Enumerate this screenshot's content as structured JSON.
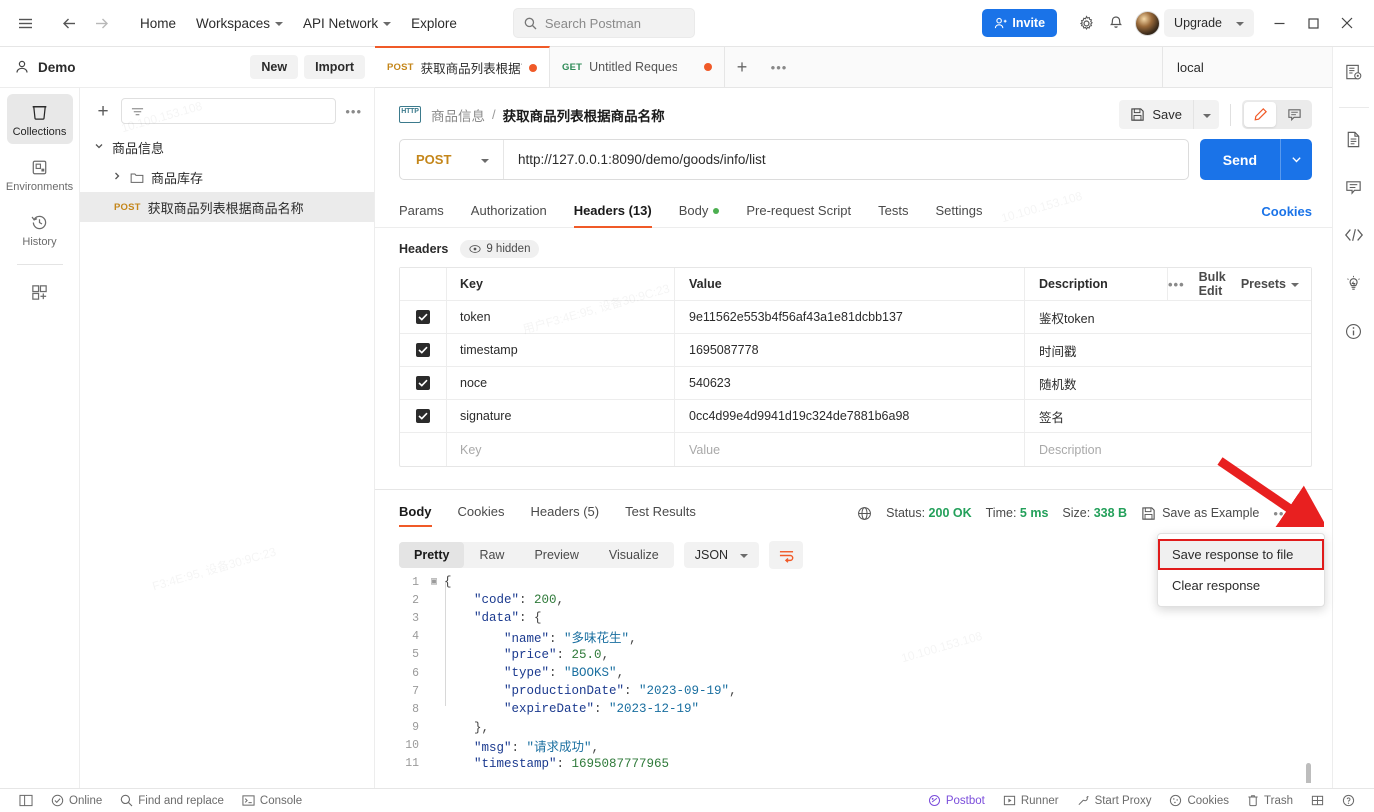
{
  "topbar": {
    "menu_icon": "hamburger-icon",
    "back_icon": "back-arrow-icon",
    "forward_icon": "forward-arrow-icon",
    "home": "Home",
    "workspaces": "Workspaces",
    "api_network": "API Network",
    "explore": "Explore",
    "search_placeholder": "Search Postman",
    "invite": "Invite",
    "settings_icon": "gear-icon",
    "notifications_icon": "bell-icon",
    "avatar": "user-avatar",
    "upgrade": "Upgrade",
    "minimize": "–",
    "maximize": "□",
    "close": "✕"
  },
  "workspace": {
    "name": "Demo",
    "new_label": "New",
    "import_label": "Import"
  },
  "rail": {
    "items": [
      {
        "label": "Collections",
        "icon": "collections-icon",
        "active": true
      },
      {
        "label": "Environments",
        "icon": "environments-icon",
        "active": false
      },
      {
        "label": "History",
        "icon": "history-icon",
        "active": false
      }
    ],
    "add_label": "add-module-icon"
  },
  "collections": {
    "filter_placeholder": "",
    "filter_icon": "filter-icon",
    "more_icon": "more-options-icon",
    "tree": [
      {
        "label": "商品信息",
        "type": "collection",
        "expanded": true,
        "method": ""
      },
      {
        "label": "商品库存",
        "type": "folder",
        "expanded": false,
        "method": ""
      },
      {
        "label": "获取商品列表根据商品名称",
        "type": "request",
        "method": "POST",
        "selected": true
      }
    ]
  },
  "tabs": {
    "items": [
      {
        "method": "POST",
        "label": "获取商品列表根据商品",
        "unsaved": true,
        "active": true
      },
      {
        "method": "GET",
        "label": "Untitled Request",
        "unsaved": true,
        "active": false
      }
    ],
    "add": "+",
    "more": "•••",
    "environment": "local"
  },
  "request": {
    "breadcrumb_root": "商品信息",
    "breadcrumb_sep": "/",
    "breadcrumb_leaf": "获取商品列表根据商品名称",
    "protocol_badge": "HTTP",
    "save_label": "Save",
    "method": "POST",
    "url": "http://127.0.0.1:8090/demo/goods/info/list",
    "send_label": "Send",
    "tabs": [
      {
        "label": "Params",
        "active": false
      },
      {
        "label": "Authorization",
        "active": false
      },
      {
        "label": "Headers (13)",
        "active": true
      },
      {
        "label": "Body",
        "active": false,
        "dot": true
      },
      {
        "label": "Pre-request Script",
        "active": false
      },
      {
        "label": "Tests",
        "active": false
      },
      {
        "label": "Settings",
        "active": false
      }
    ],
    "cookies_link": "Cookies"
  },
  "headers": {
    "section_label": "Headers",
    "hidden_label": "9 hidden",
    "columns": [
      "Key",
      "Value",
      "Description"
    ],
    "bulk_edit": "Bulk Edit",
    "presets": "Presets",
    "more_icon": "more-options-icon",
    "rows": [
      {
        "checked": true,
        "key": "token",
        "value": "9e11562e553b4f56af43a1e81dcbb137",
        "description": "鉴权token"
      },
      {
        "checked": true,
        "key": "timestamp",
        "value": "1695087778",
        "description": "时间戳"
      },
      {
        "checked": true,
        "key": "noce",
        "value": "540623",
        "description": "随机数"
      },
      {
        "checked": true,
        "key": "signature",
        "value": "0cc4d99e4d9941d19c324de7881b6a98",
        "description": "签名"
      }
    ],
    "empty_row": {
      "key": "Key",
      "value": "Value",
      "description": "Description"
    }
  },
  "response": {
    "tabs": [
      {
        "label": "Body",
        "active": true
      },
      {
        "label": "Cookies",
        "active": false
      },
      {
        "label": "Headers (5)",
        "active": false
      },
      {
        "label": "Test Results",
        "active": false
      }
    ],
    "status_label": "Status:",
    "status_value": "200 OK",
    "time_label": "Time:",
    "time_value": "5 ms",
    "size_label": "Size:",
    "size_value": "338 B",
    "save_example": "Save as Example",
    "more_icon": "more-options-icon",
    "views": [
      {
        "label": "Pretty",
        "active": true
      },
      {
        "label": "Raw",
        "active": false
      },
      {
        "label": "Preview",
        "active": false
      },
      {
        "label": "Visualize",
        "active": false
      }
    ],
    "format": "JSON",
    "wrap_icon": "wrap-lines-icon",
    "body_lines": [
      {
        "n": 1,
        "tokens": [
          {
            "t": "{",
            "c": "p"
          }
        ]
      },
      {
        "n": 2,
        "tokens": [
          {
            "t": "    \"code\"",
            "c": "k"
          },
          {
            "t": ": ",
            "c": "p"
          },
          {
            "t": "200",
            "c": "n"
          },
          {
            "t": ",",
            "c": "p"
          }
        ]
      },
      {
        "n": 3,
        "tokens": [
          {
            "t": "    \"data\"",
            "c": "k"
          },
          {
            "t": ": {",
            "c": "p"
          }
        ]
      },
      {
        "n": 4,
        "tokens": [
          {
            "t": "        \"name\"",
            "c": "k"
          },
          {
            "t": ": ",
            "c": "p"
          },
          {
            "t": "\"多味花生\"",
            "c": "s"
          },
          {
            "t": ",",
            "c": "p"
          }
        ]
      },
      {
        "n": 5,
        "tokens": [
          {
            "t": "        \"price\"",
            "c": "k"
          },
          {
            "t": ": ",
            "c": "p"
          },
          {
            "t": "25.0",
            "c": "n"
          },
          {
            "t": ",",
            "c": "p"
          }
        ]
      },
      {
        "n": 6,
        "tokens": [
          {
            "t": "        \"type\"",
            "c": "k"
          },
          {
            "t": ": ",
            "c": "p"
          },
          {
            "t": "\"BOOKS\"",
            "c": "s"
          },
          {
            "t": ",",
            "c": "p"
          }
        ]
      },
      {
        "n": 7,
        "tokens": [
          {
            "t": "        \"productionDate\"",
            "c": "k"
          },
          {
            "t": ": ",
            "c": "p"
          },
          {
            "t": "\"2023-09-19\"",
            "c": "s"
          },
          {
            "t": ",",
            "c": "p"
          }
        ]
      },
      {
        "n": 8,
        "tokens": [
          {
            "t": "        \"expireDate\"",
            "c": "k"
          },
          {
            "t": ": ",
            "c": "p"
          },
          {
            "t": "\"2023-12-19\"",
            "c": "s"
          }
        ]
      },
      {
        "n": 9,
        "tokens": [
          {
            "t": "    },",
            "c": "p"
          }
        ]
      },
      {
        "n": 10,
        "tokens": [
          {
            "t": "    \"msg\"",
            "c": "k"
          },
          {
            "t": ": ",
            "c": "p"
          },
          {
            "t": "\"请求成功\"",
            "c": "s"
          },
          {
            "t": ",",
            "c": "p"
          }
        ]
      },
      {
        "n": 11,
        "tokens": [
          {
            "t": "    \"timestamp\"",
            "c": "k"
          },
          {
            "t": ": ",
            "c": "p"
          },
          {
            "t": "1695087777965",
            "c": "n"
          }
        ]
      }
    ]
  },
  "context_menu": {
    "items": [
      {
        "label": "Save response to file",
        "highlighted": true
      },
      {
        "label": "Clear response",
        "highlighted": false
      }
    ],
    "highlight_color": "#e01b1b",
    "arrow_color": "#e82020"
  },
  "bottombar": {
    "left": [
      {
        "label": "",
        "icon": "sidebar-toggle-icon"
      },
      {
        "label": "Online",
        "icon": "online-icon"
      },
      {
        "label": "Find and replace",
        "icon": "search-icon"
      },
      {
        "label": "Console",
        "icon": "console-icon"
      }
    ],
    "right": [
      {
        "label": "Postbot",
        "icon": "postbot-icon"
      },
      {
        "label": "Runner",
        "icon": "runner-icon"
      },
      {
        "label": "Start Proxy",
        "icon": "proxy-icon"
      },
      {
        "label": "Cookies",
        "icon": "cookies-icon"
      },
      {
        "label": "Trash",
        "icon": "trash-icon"
      },
      {
        "label": "",
        "icon": "layout-icon"
      },
      {
        "label": "",
        "icon": "help-icon"
      }
    ]
  },
  "right_rail": {
    "items": [
      {
        "icon": "docs-preview-icon"
      },
      {
        "icon": "documentation-icon"
      },
      {
        "icon": "comments-icon"
      },
      {
        "icon": "code-icon"
      },
      {
        "icon": "lightbulb-icon"
      },
      {
        "icon": "info-icon"
      }
    ]
  },
  "watermarks": [
    "用户F3:4E:95, 设备30:9C:23",
    "10.100.153.108",
    "F3:4E:95, 设备30:9C:23"
  ]
}
